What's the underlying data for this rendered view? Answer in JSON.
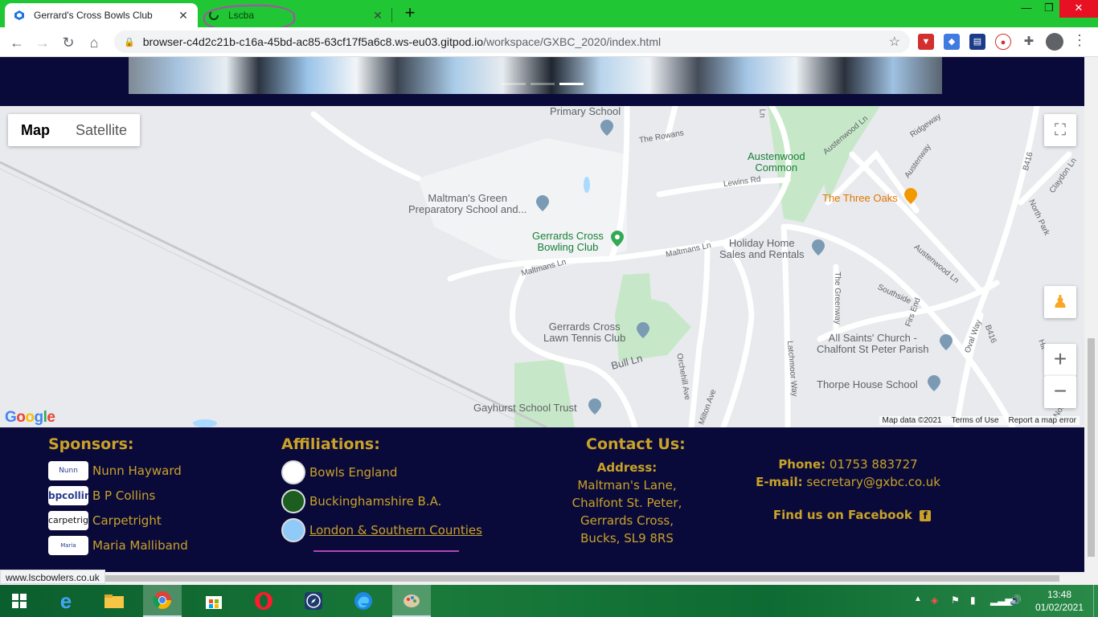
{
  "browser": {
    "tabs": [
      {
        "title": "Gerrard's Cross Bowls Club",
        "active": true
      },
      {
        "title": "Lscba",
        "active": false
      }
    ],
    "url_host": "browser-c4d2c21b-c16a-45bd-ac85-63cf17f5a6c8.ws-eu03.gitpod.io",
    "url_path": "/workspace/GXBC_2020/index.html",
    "status_url": "www.lscbowlers.co.uk",
    "accent_color": "#20c633"
  },
  "map": {
    "type_buttons": {
      "map": "Map",
      "satellite": "Satellite"
    },
    "zoom_in": "+",
    "zoom_out": "−",
    "logo": "Google",
    "attribution": {
      "data": "Map data ©2021",
      "terms": "Terms of Use",
      "report": "Report a map error"
    },
    "places": {
      "primary_school": "Primary School",
      "the_rowans": "The Rowans",
      "maltmans_green": "Maltman's Green\nPreparatory School and...",
      "gx_bowling": "Gerrards Cross\nBowling Club",
      "maltmans_ln_1": "Maltmans Ln",
      "maltmans_ln_2": "Maltmans Ln",
      "austenwood_common": "Austenwood\nCommon",
      "lewins_rd": "Lewins Rd",
      "three_oaks": "The Three Oaks",
      "holiday_home": "Holiday Home\nSales and Rentals",
      "austenwood_ln": "Austenwood Ln",
      "austenwood_ln_top": "Austenwood Ln",
      "austenway": "Austenway",
      "b416_top": "B416",
      "b416_bottom": "B416",
      "claydon_ln": "Claydon Ln",
      "north_park": "North Park",
      "ridgeway": "Ridgeway",
      "the_greenway": "The Greenway",
      "southside": "Southside",
      "firs_end": "Firs End",
      "oval_way": "Oval Way",
      "all_saints": "All Saints' Church -\nChalfont St Peter Parish",
      "lawn_tennis": "Gerrards Cross\nLawn Tennis Club",
      "bull_ln": "Bull Ln",
      "orchehill": "Orchehill Ave",
      "milton_ave": "Milton Ave",
      "latchmoor": "Latchmoor Way",
      "thorpe_house": "Thorpe House School",
      "gayhurst": "Gayhurst School Trust",
      "north_bottom": "North",
      "hit": "Hit",
      "ln_top": "Ln"
    }
  },
  "footer": {
    "sponsors_title": "Sponsors:",
    "sponsors": [
      {
        "name": "Nunn Hayward",
        "logo_text": "Nunn Hayward"
      },
      {
        "name": "B P Collins",
        "logo_text": "bpcollins"
      },
      {
        "name": "Carpetright",
        "logo_text": "carpetright"
      },
      {
        "name": "Maria Malliband",
        "logo_text": "Maria Malliband"
      }
    ],
    "affiliations_title": "Affiliations:",
    "affiliations": [
      {
        "name": "Bowls England"
      },
      {
        "name": "Buckinghamshire B.A."
      },
      {
        "name": "London & Southern Counties"
      }
    ],
    "contact_title": "Contact Us:",
    "address_label": "Address:",
    "address_lines": [
      "Maltman's Lane,",
      "Chalfont St. Peter,",
      "Gerrards Cross,",
      "Bucks, SL9 8RS"
    ],
    "phone_label": "Phone:",
    "phone": "01753 883727",
    "email_label": "E-mail:",
    "email": "secretary@gxbc.co.uk",
    "facebook": "Find us on Facebook",
    "text_color": "#c9a227",
    "bg_color": "#0a0a3a"
  },
  "taskbar": {
    "time": "13:48",
    "date": "01/02/2021"
  }
}
